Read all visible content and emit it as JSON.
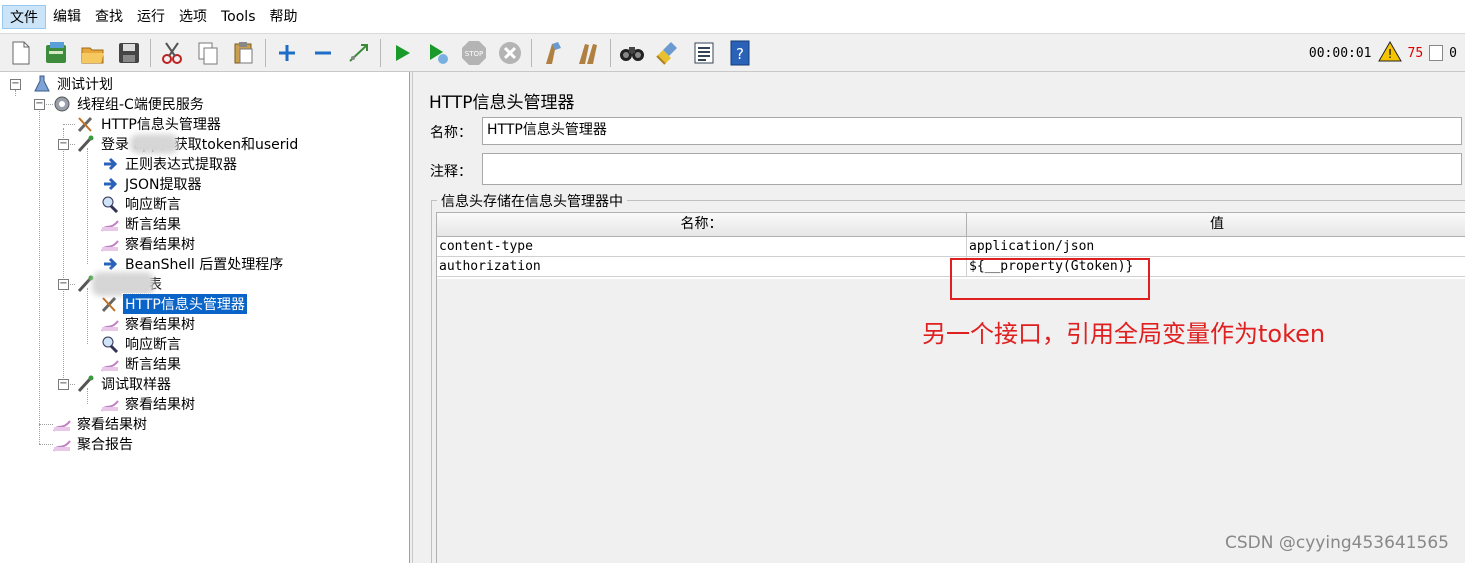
{
  "menu": [
    {
      "label": "文件",
      "active": true
    },
    {
      "label": "编辑"
    },
    {
      "label": "查找"
    },
    {
      "label": "运行"
    },
    {
      "label": "选项"
    },
    {
      "label": "Tools"
    },
    {
      "label": "帮助"
    }
  ],
  "toolbar": {
    "timer": "00:00:01",
    "warning_count": "75",
    "error_count": "0"
  },
  "tree": {
    "items": [
      {
        "label": "测试计划",
        "icon": "test-plan-icon"
      },
      {
        "label": "线程组-C端便民服务",
        "icon": "gear-icon"
      },
      {
        "label": "HTTP信息头管理器",
        "icon": "wrench-icon"
      },
      {
        "label": "登录          app，获取token和userid",
        "icon": "pipette-icon"
      },
      {
        "label": "正则表达式提取器",
        "icon": "arrow-icon"
      },
      {
        "label": "JSON提取器",
        "icon": "arrow-icon"
      },
      {
        "label": "响应断言",
        "icon": "magnifier-icon"
      },
      {
        "label": "断言结果",
        "icon": "chart-icon"
      },
      {
        "label": "察看结果树",
        "icon": "chart-icon"
      },
      {
        "label": "BeanShell 后置处理程序",
        "icon": "arrow-icon"
      },
      {
        "label": "            -全部列表",
        "icon": "pipette-icon"
      },
      {
        "label": "HTTP信息头管理器",
        "icon": "wrench-icon"
      },
      {
        "label": "察看结果树",
        "icon": "chart-icon"
      },
      {
        "label": "响应断言",
        "icon": "magnifier-icon"
      },
      {
        "label": "断言结果",
        "icon": "chart-icon"
      },
      {
        "label": "调试取样器",
        "icon": "pipette-icon"
      },
      {
        "label": "察看结果树",
        "icon": "chart-icon"
      },
      {
        "label": "察看结果树",
        "icon": "chart-icon"
      },
      {
        "label": "聚合报告",
        "icon": "chart-icon"
      }
    ]
  },
  "panel": {
    "title": "HTTP信息头管理器",
    "name_label": "名称：",
    "name_value": "HTTP信息头管理器",
    "comment_label": "注释：",
    "comment_value": "",
    "group_title": "信息头存储在信息头管理器中",
    "table": {
      "headers": [
        "名称：",
        "值"
      ],
      "rows": [
        [
          "content-type",
          "application/json"
        ],
        [
          "authorization",
          "${__property(Gtoken)}"
        ]
      ]
    }
  },
  "annotation": "另一个接口，引用全局变量作为token",
  "watermark": "CSDN @cyying453641565",
  "colors": {
    "accent": "#0a64c8",
    "annotation": "#e02020",
    "error": "#dd0000"
  }
}
